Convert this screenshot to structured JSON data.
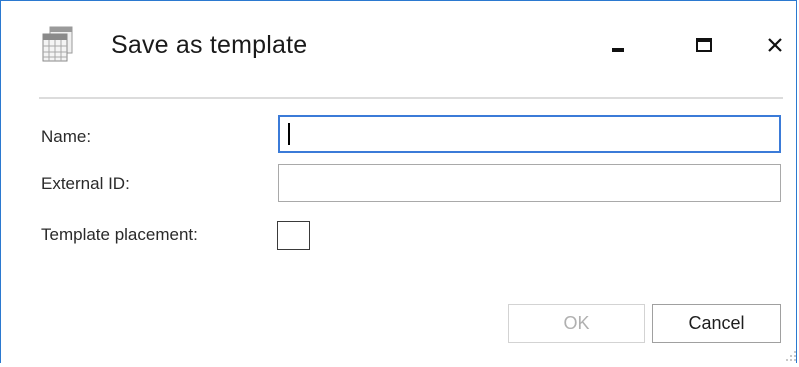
{
  "dialog": {
    "title": "Save as template",
    "icon": "calendar-grid-icon",
    "controls": {
      "minimize": "minimize-icon",
      "maximize": "maximize-icon",
      "close": "close-icon"
    }
  },
  "form": {
    "name_label": "Name:",
    "name_value": "",
    "external_id_label": "External ID:",
    "external_id_value": "",
    "template_placement_label": "Template placement:",
    "template_placement_checked": false
  },
  "buttons": {
    "ok_label": "OK",
    "ok_enabled": false,
    "cancel_label": "Cancel"
  },
  "colors": {
    "border_accent": "#2b79d0",
    "focus_border": "#3b7bd8",
    "disabled_text": "#b0b0b0"
  }
}
